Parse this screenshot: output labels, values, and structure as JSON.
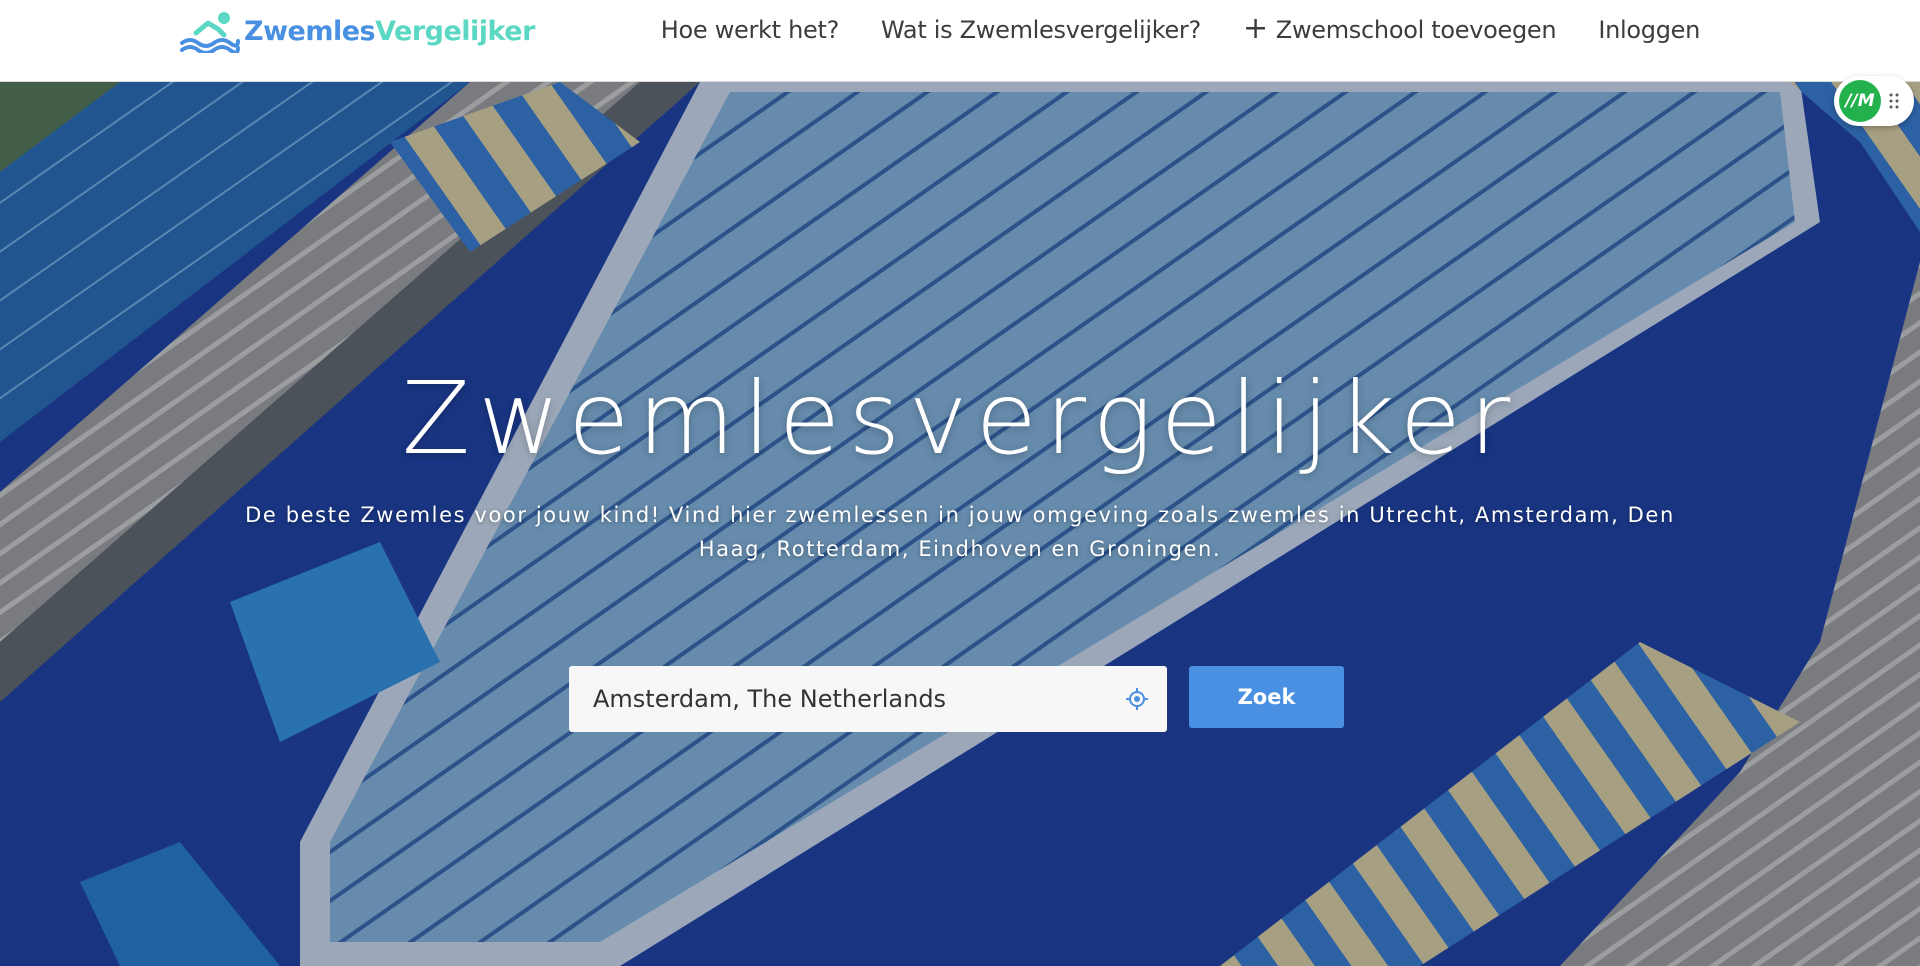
{
  "header": {
    "logo": {
      "part1": "Zwemles",
      "part2": "Vergelijker",
      "icon": "swimmer-logo-icon"
    },
    "nav": [
      {
        "label": "Hoe werkt het?"
      },
      {
        "label": "Wat is Zwemlesvergelijker?"
      },
      {
        "label": "Zwemschool toevoegen",
        "icon": "plus-icon"
      },
      {
        "label": "Inloggen"
      }
    ]
  },
  "hero": {
    "title": "Zwemlesvergelijker",
    "subtitle_line1": "De beste Zwemles voor jouw kind! Vind hier zwemlessen in jouw omgeving zoals zwemles in Utrecht, Amsterdam, Den",
    "subtitle_line2": "Haag, Rotterdam, Eindhoven en Groningen.",
    "search": {
      "value": "Amsterdam, The Netherlands",
      "icon": "locate-icon",
      "button_label": "Zoek"
    }
  },
  "widget": {
    "badge_text": "//M",
    "icon": "drag-grip-icon"
  },
  "colors": {
    "brand_blue": "#4a90e2",
    "brand_teal": "#5ad8c4",
    "widget_green": "#23b14d",
    "nav_text": "#3d3d3d"
  }
}
